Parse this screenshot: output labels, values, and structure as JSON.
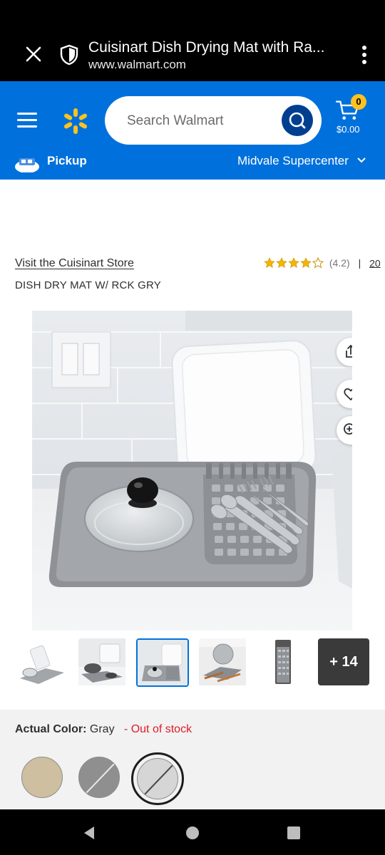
{
  "browser": {
    "title": "Cuisinart Dish Drying Mat with Ra...",
    "url": "www.walmart.com",
    "icons": [
      "close-icon",
      "shield-icon",
      "more-vert-icon"
    ]
  },
  "header": {
    "search_placeholder": "Search Walmart",
    "cart_count": "0",
    "cart_total": "$0.00",
    "pickup_label": "Pickup",
    "store_label": "Midvale Supercenter",
    "colors": {
      "brand_blue": "#0071dc",
      "spark_yellow": "#ffc220",
      "search_button": "#003f8f"
    }
  },
  "product": {
    "store_link": "Visit the Cuisinart Store",
    "rating_value": "(4.2)",
    "rating_stars": 4.2,
    "rating_separator": "|",
    "review_count": "20",
    "name": "DISH DRY MAT W/ RCK GRY",
    "more_images": "+ 14",
    "selected_thumbnail_index": 2
  },
  "color_selector": {
    "label": "Actual Color:",
    "value": "Gray",
    "status_dash": "-",
    "status": "Out of stock",
    "swatches": [
      {
        "name": "Beige",
        "hex": "#cdbf9f",
        "available": true
      },
      {
        "name": "Dark Gray",
        "hex": "#8f8f8f",
        "available": false
      },
      {
        "name": "Gray",
        "hex": "#d6d6d6",
        "available": false,
        "selected": true
      }
    ]
  }
}
